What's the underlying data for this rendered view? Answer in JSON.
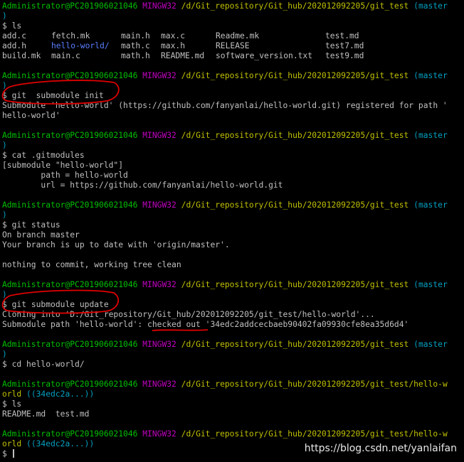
{
  "colors": {
    "background": "#000000",
    "text": "#c0c0c0",
    "user_host": "#00c000",
    "mingw": "#c000c0",
    "path": "#c0c000",
    "branch": "#00a0c0",
    "directory": "#5a7cff",
    "annotation": "#e00000"
  },
  "prompt": {
    "user_host": "Administrator@PC201906021046",
    "shell": "MINGW32",
    "path": "/d/Git_repository/Git_hub/202012092205/git_test",
    "branch_part1": "(master",
    "branch_part2": ")",
    "sub_path_part1": "/d/Git_repository/Git_hub/202012092205/git_test/hello-w",
    "sub_path_part2": "orld",
    "sub_branch": "((34edc2a...))",
    "symbol": "$"
  },
  "commands": {
    "ls": "ls",
    "submodule_init": "git  submodule init",
    "cat_gitmodules": "cat .gitmodules",
    "status": "git status",
    "submodule_update": "git submodule update",
    "cd": "cd hello-world/"
  },
  "ls_output": {
    "row1": [
      "add.c",
      "fetch.mk",
      "main.h",
      "max.c",
      "Readme.mk",
      "test.md"
    ],
    "row2": [
      "add.h",
      "hello-world/",
      "math.c",
      "max.h",
      "RELEASE",
      "test7.md"
    ],
    "row3": [
      "build.mk",
      "main.c",
      "math.h",
      "README.md",
      "software_version.txt",
      "test9.md"
    ]
  },
  "init_output": {
    "line1": "Submodule 'hello-world' (https://github.com/fanyanlai/hello-world.git) registered for path '",
    "line2": "hello-world'"
  },
  "gitmodules_output": {
    "line1": "[submodule \"hello-world\"]",
    "line2": "        path = hello-world",
    "line3": "        url = https://github.com/fanyanlai/hello-world.git"
  },
  "status_output": {
    "line1": "On branch master",
    "line2": "Your branch is up to date with 'origin/master'.",
    "line3": "nothing to commit, working tree clean"
  },
  "update_output": {
    "line1": "Cloning into 'D:/Git_repository/Git_hub/202012092205/git_test/hello-world'...",
    "line2": "Submodule path 'hello-world': checked out '34edc2addcecbaeb90402fa09930cfe8ea35d6d4'"
  },
  "ls2_output": "README.md  test.md",
  "watermark": "https://blog.csdn.net/yanlaifan"
}
